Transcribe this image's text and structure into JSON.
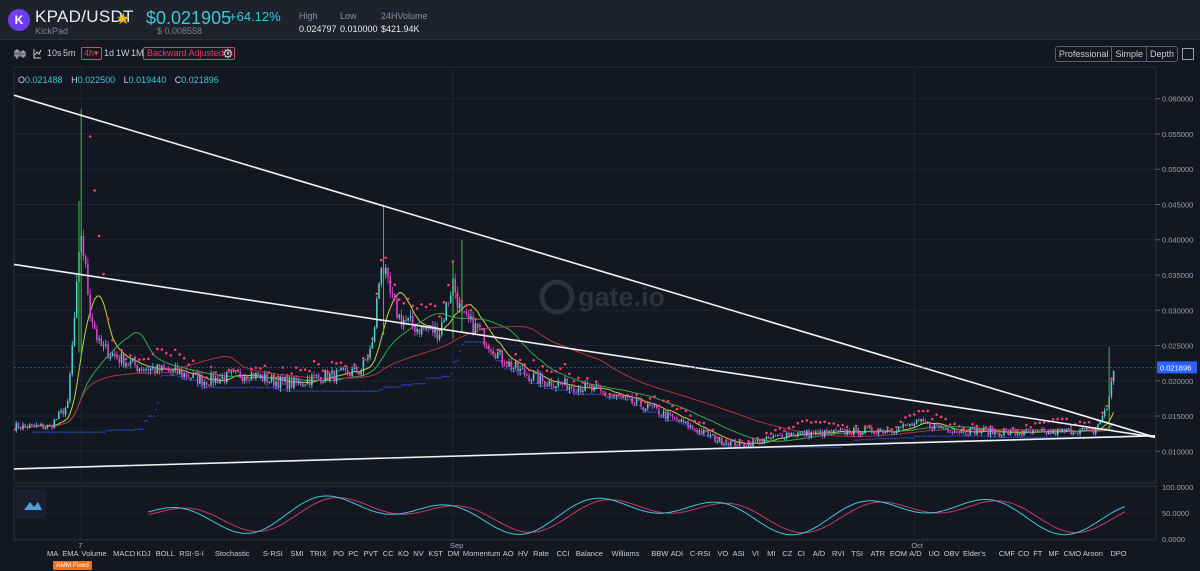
{
  "header": {
    "logo_text": "K",
    "pair": "KPAD/USDT",
    "name": "KickPad",
    "last_price": "$0.021905",
    "last_price_usd": "$ 0.008558",
    "change_pct": "+64.12%",
    "high_label": "High",
    "high_value": "0.024797",
    "low_label": "Low",
    "low_value": "0.010000",
    "volume_label": "24HVolume",
    "volume_value": "$421.94K"
  },
  "toolbar": {
    "intervals": [
      "10s",
      "5m",
      "4h",
      "1d",
      "1W",
      "1M"
    ],
    "active_interval": "4h",
    "adjust_label": "Backward Adjusted",
    "views": [
      "Professional",
      "Simple",
      "Depth"
    ]
  },
  "ohlc": {
    "o": "0.021488",
    "h": "0.022500",
    "l": "0.019440",
    "c": "0.021896"
  },
  "colors": {
    "up": "#4fd0c4",
    "down": "#d946d0",
    "sar": "#ff3b6b",
    "trend": "#f2f2f2"
  },
  "indicators": [
    "MA",
    "EMA",
    "Volume",
    "MACD",
    "KDJ",
    "BOLL",
    "RSI-S-I",
    "Stochastic",
    "S-RSI",
    "SMI",
    "TRIX",
    "PO",
    "PC",
    "PVT",
    "CC",
    "KO",
    "NV",
    "KST",
    "DM",
    "Momentum",
    "AO",
    "HV",
    "Rate",
    "CCI",
    "Balance",
    "Williams",
    "BBW",
    "ADI",
    "C-RSI",
    "VO",
    "ASI",
    "VI",
    "MI",
    "CZ",
    "CI",
    "A/D",
    "RVI",
    "TSI",
    "ATR",
    "EOM",
    "A/D",
    "UO",
    "OBV",
    "Elder's",
    "CMF",
    "CO",
    "FT",
    "MF",
    "CMO",
    "Aroon",
    "DPO"
  ],
  "amm_label": "AMM Fixed",
  "chart_data": {
    "type": "candlestick",
    "watermark": "gate.io",
    "x_tick_labels": [
      "7",
      "Sep",
      "Oct"
    ],
    "y_ticks": [
      0.01,
      0.015,
      0.02,
      0.025,
      0.03,
      0.035,
      0.04,
      0.045,
      0.05,
      0.055,
      0.06
    ],
    "y_tick_labels": [
      "0.010000",
      "0.015000",
      "0.020000",
      "0.025000",
      "0.030000",
      "0.035000",
      "0.040000",
      "0.045000",
      "0.050000",
      "0.055000",
      "0.060000"
    ],
    "ylim": [
      0.0055,
      0.0645
    ],
    "current_price_label": "0.021896",
    "current_price": 0.021896,
    "price_path": [
      [
        0,
        0.0135
      ],
      [
        16,
        0.0135
      ],
      [
        20,
        0.015
      ],
      [
        24,
        0.0165
      ],
      [
        30,
        0.041
      ],
      [
        34,
        0.03
      ],
      [
        38,
        0.025
      ],
      [
        45,
        0.0235
      ],
      [
        55,
        0.022
      ],
      [
        65,
        0.0215
      ],
      [
        75,
        0.021
      ],
      [
        85,
        0.02
      ],
      [
        95,
        0.0205
      ],
      [
        105,
        0.021
      ],
      [
        115,
        0.02
      ],
      [
        125,
        0.0195
      ],
      [
        135,
        0.0205
      ],
      [
        145,
        0.0208
      ],
      [
        155,
        0.0215
      ],
      [
        160,
        0.025
      ],
      [
        164,
        0.037
      ],
      [
        168,
        0.032
      ],
      [
        172,
        0.029
      ],
      [
        180,
        0.0275
      ],
      [
        190,
        0.027
      ],
      [
        196,
        0.034
      ],
      [
        200,
        0.029
      ],
      [
        206,
        0.0275
      ],
      [
        212,
        0.0255
      ],
      [
        218,
        0.023
      ],
      [
        225,
        0.0215
      ],
      [
        235,
        0.02
      ],
      [
        245,
        0.0195
      ],
      [
        255,
        0.019
      ],
      [
        265,
        0.018
      ],
      [
        275,
        0.017
      ],
      [
        285,
        0.016
      ],
      [
        295,
        0.0145
      ],
      [
        305,
        0.013
      ],
      [
        315,
        0.0115
      ],
      [
        325,
        0.011
      ],
      [
        335,
        0.0115
      ],
      [
        345,
        0.0125
      ],
      [
        360,
        0.0125
      ],
      [
        375,
        0.0128
      ],
      [
        390,
        0.013
      ],
      [
        405,
        0.014
      ],
      [
        420,
        0.013
      ],
      [
        435,
        0.0128
      ],
      [
        450,
        0.0125
      ],
      [
        465,
        0.0127
      ],
      [
        475,
        0.013
      ],
      [
        482,
        0.0128
      ],
      [
        488,
        0.016
      ],
      [
        491,
        0.0219
      ]
    ],
    "spikes": [
      {
        "i": 30,
        "high": 0.0585,
        "low": 0.023
      },
      {
        "i": 29,
        "high": 0.0455,
        "low": 0.024
      },
      {
        "i": 165,
        "high": 0.045,
        "low": 0.0265
      },
      {
        "i": 196,
        "high": 0.037,
        "low": 0.026
      },
      {
        "i": 200,
        "high": 0.04,
        "low": 0.027
      },
      {
        "i": 489,
        "high": 0.0248,
        "low": 0.013
      }
    ],
    "trend_lines": [
      {
        "name": "upper-resistance",
        "x0": 0,
        "y0": 0.0605,
        "x1": 505,
        "y1": 0.012
      },
      {
        "name": "mid-resistance",
        "x0": 0,
        "y0": 0.0365,
        "x1": 505,
        "y1": 0.012
      },
      {
        "name": "support",
        "x0": 0,
        "y0": 0.0075,
        "x1": 505,
        "y1": 0.0122
      }
    ],
    "oscillator": {
      "y_tick_labels": [
        "100.0000",
        "50.0000",
        "0.0000"
      ],
      "ylim": [
        0,
        100
      ]
    }
  }
}
